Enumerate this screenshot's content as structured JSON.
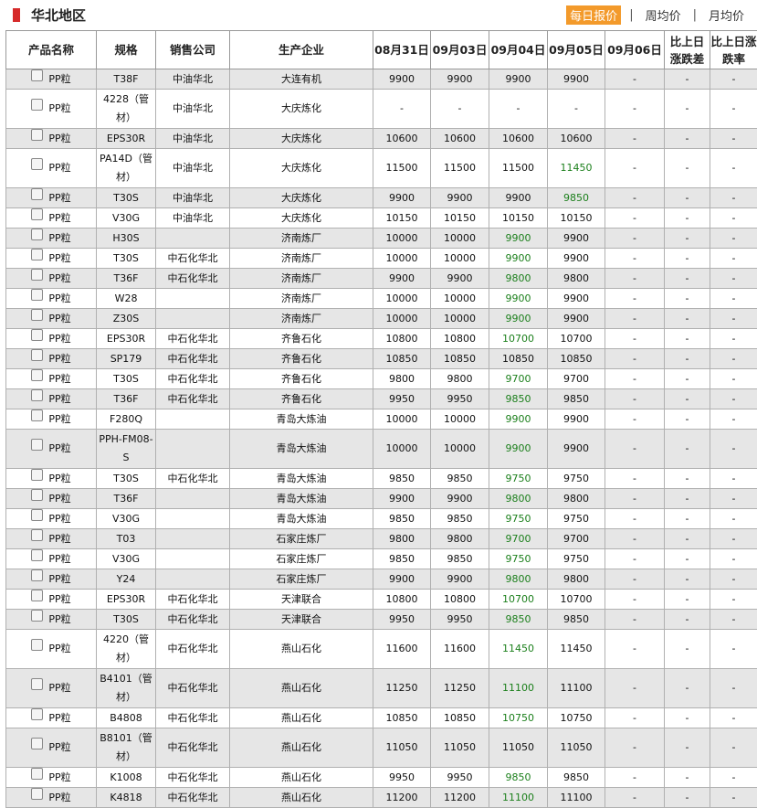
{
  "region_title": "华北地区",
  "tabs": [
    {
      "label": "每日报价",
      "active": true
    },
    {
      "label": "周均价",
      "active": false
    },
    {
      "label": "月均价",
      "active": false
    }
  ],
  "colors": {
    "accent": "#f39a2b",
    "marker": "#d62a2a",
    "down": "#1b7f1b",
    "alt_row": "#e6e6e6"
  },
  "columns": [
    "产品名称",
    "规格",
    "销售公司",
    "生产企业",
    "08月31日",
    "09月03日",
    "09月04日",
    "09月05日",
    "09月06日",
    "比上日涨跌差",
    "比上日涨跌率"
  ],
  "rows": [
    {
      "name": "PP粒",
      "spec": "T38F",
      "seller": "中油华北",
      "producer": "大连有机",
      "prices": [
        "9900",
        "9900",
        "9900",
        "9900"
      ],
      "p6": "-",
      "diff": "-",
      "rate": "-",
      "tall": false,
      "down3": false
    },
    {
      "name": "PP粒",
      "spec": "4228（管材）",
      "seller": "中油华北",
      "producer": "大庆炼化",
      "prices": [
        "-",
        "-",
        "-",
        "-"
      ],
      "p6": "-",
      "diff": "-",
      "rate": "-",
      "tall": true,
      "down3": false
    },
    {
      "name": "PP粒",
      "spec": "EPS30R",
      "seller": "中油华北",
      "producer": "大庆炼化",
      "prices": [
        "10600",
        "10600",
        "10600",
        "10600"
      ],
      "p6": "-",
      "diff": "-",
      "rate": "-",
      "tall": false,
      "down3": false
    },
    {
      "name": "PP粒",
      "spec": "PA14D（管材）",
      "seller": "中油华北",
      "producer": "大庆炼化",
      "prices": [
        "11500",
        "11500",
        "11500",
        "11450"
      ],
      "p6": "-",
      "diff": "-",
      "rate": "-",
      "tall": true,
      "down3": true
    },
    {
      "name": "PP粒",
      "spec": "T30S",
      "seller": "中油华北",
      "producer": "大庆炼化",
      "prices": [
        "9900",
        "9900",
        "9900",
        "9850"
      ],
      "p6": "-",
      "diff": "-",
      "rate": "-",
      "tall": false,
      "down3": true
    },
    {
      "name": "PP粒",
      "spec": "V30G",
      "seller": "中油华北",
      "producer": "大庆炼化",
      "prices": [
        "10150",
        "10150",
        "10150",
        "10150"
      ],
      "p6": "-",
      "diff": "-",
      "rate": "-",
      "tall": false,
      "down3": false
    },
    {
      "name": "PP粒",
      "spec": "H30S",
      "seller": "",
      "producer": "济南炼厂",
      "prices": [
        "10000",
        "10000",
        "9900",
        "9900"
      ],
      "p6": "-",
      "diff": "-",
      "rate": "-",
      "tall": false,
      "down2": true
    },
    {
      "name": "PP粒",
      "spec": "T30S",
      "seller": "中石化华北",
      "producer": "济南炼厂",
      "prices": [
        "10000",
        "10000",
        "9900",
        "9900"
      ],
      "p6": "-",
      "diff": "-",
      "rate": "-",
      "tall": false,
      "down2": true
    },
    {
      "name": "PP粒",
      "spec": "T36F",
      "seller": "中石化华北",
      "producer": "济南炼厂",
      "prices": [
        "9900",
        "9900",
        "9800",
        "9800"
      ],
      "p6": "-",
      "diff": "-",
      "rate": "-",
      "tall": false,
      "down2": true
    },
    {
      "name": "PP粒",
      "spec": "W28",
      "seller": "",
      "producer": "济南炼厂",
      "prices": [
        "10000",
        "10000",
        "9900",
        "9900"
      ],
      "p6": "-",
      "diff": "-",
      "rate": "-",
      "tall": false,
      "down2": true
    },
    {
      "name": "PP粒",
      "spec": "Z30S",
      "seller": "",
      "producer": "济南炼厂",
      "prices": [
        "10000",
        "10000",
        "9900",
        "9900"
      ],
      "p6": "-",
      "diff": "-",
      "rate": "-",
      "tall": false,
      "down2": true
    },
    {
      "name": "PP粒",
      "spec": "EPS30R",
      "seller": "中石化华北",
      "producer": "齐鲁石化",
      "prices": [
        "10800",
        "10800",
        "10700",
        "10700"
      ],
      "p6": "-",
      "diff": "-",
      "rate": "-",
      "tall": false,
      "down2": true
    },
    {
      "name": "PP粒",
      "spec": "SP179",
      "seller": "中石化华北",
      "producer": "齐鲁石化",
      "prices": [
        "10850",
        "10850",
        "10850",
        "10850"
      ],
      "p6": "-",
      "diff": "-",
      "rate": "-",
      "tall": false
    },
    {
      "name": "PP粒",
      "spec": "T30S",
      "seller": "中石化华北",
      "producer": "齐鲁石化",
      "prices": [
        "9800",
        "9800",
        "9700",
        "9700"
      ],
      "p6": "-",
      "diff": "-",
      "rate": "-",
      "tall": false,
      "down2": true
    },
    {
      "name": "PP粒",
      "spec": "T36F",
      "seller": "中石化华北",
      "producer": "齐鲁石化",
      "prices": [
        "9950",
        "9950",
        "9850",
        "9850"
      ],
      "p6": "-",
      "diff": "-",
      "rate": "-",
      "tall": false,
      "down2": true
    },
    {
      "name": "PP粒",
      "spec": "F280Q",
      "seller": "",
      "producer": "青岛大炼油",
      "prices": [
        "10000",
        "10000",
        "9900",
        "9900"
      ],
      "p6": "-",
      "diff": "-",
      "rate": "-",
      "tall": false,
      "down2": true
    },
    {
      "name": "PP粒",
      "spec": "PPH-FM08-S",
      "seller": "",
      "producer": "青岛大炼油",
      "prices": [
        "10000",
        "10000",
        "9900",
        "9900"
      ],
      "p6": "-",
      "diff": "-",
      "rate": "-",
      "tall": true,
      "down2": true
    },
    {
      "name": "PP粒",
      "spec": "T30S",
      "seller": "中石化华北",
      "producer": "青岛大炼油",
      "prices": [
        "9850",
        "9850",
        "9750",
        "9750"
      ],
      "p6": "-",
      "diff": "-",
      "rate": "-",
      "tall": false,
      "down2": true
    },
    {
      "name": "PP粒",
      "spec": "T36F",
      "seller": "",
      "producer": "青岛大炼油",
      "prices": [
        "9900",
        "9900",
        "9800",
        "9800"
      ],
      "p6": "-",
      "diff": "-",
      "rate": "-",
      "tall": false,
      "down2": true
    },
    {
      "name": "PP粒",
      "spec": "V30G",
      "seller": "",
      "producer": "青岛大炼油",
      "prices": [
        "9850",
        "9850",
        "9750",
        "9750"
      ],
      "p6": "-",
      "diff": "-",
      "rate": "-",
      "tall": false,
      "down2": true
    },
    {
      "name": "PP粒",
      "spec": "T03",
      "seller": "",
      "producer": "石家庄炼厂",
      "prices": [
        "9800",
        "9800",
        "9700",
        "9700"
      ],
      "p6": "-",
      "diff": "-",
      "rate": "-",
      "tall": false,
      "down2": true
    },
    {
      "name": "PP粒",
      "spec": "V30G",
      "seller": "",
      "producer": "石家庄炼厂",
      "prices": [
        "9850",
        "9850",
        "9750",
        "9750"
      ],
      "p6": "-",
      "diff": "-",
      "rate": "-",
      "tall": false,
      "down2": true
    },
    {
      "name": "PP粒",
      "spec": "Y24",
      "seller": "",
      "producer": "石家庄炼厂",
      "prices": [
        "9900",
        "9900",
        "9800",
        "9800"
      ],
      "p6": "-",
      "diff": "-",
      "rate": "-",
      "tall": false,
      "down2": true
    },
    {
      "name": "PP粒",
      "spec": "EPS30R",
      "seller": "中石化华北",
      "producer": "天津联合",
      "prices": [
        "10800",
        "10800",
        "10700",
        "10700"
      ],
      "p6": "-",
      "diff": "-",
      "rate": "-",
      "tall": false,
      "down2": true
    },
    {
      "name": "PP粒",
      "spec": "T30S",
      "seller": "中石化华北",
      "producer": "天津联合",
      "prices": [
        "9950",
        "9950",
        "9850",
        "9850"
      ],
      "p6": "-",
      "diff": "-",
      "rate": "-",
      "tall": false,
      "down2": true
    },
    {
      "name": "PP粒",
      "spec": "4220（管材）",
      "seller": "中石化华北",
      "producer": "燕山石化",
      "prices": [
        "11600",
        "11600",
        "11450",
        "11450"
      ],
      "p6": "-",
      "diff": "-",
      "rate": "-",
      "tall": true,
      "down2": true
    },
    {
      "name": "PP粒",
      "spec": "B4101（管材）",
      "seller": "中石化华北",
      "producer": "燕山石化",
      "prices": [
        "11250",
        "11250",
        "11100",
        "11100"
      ],
      "p6": "-",
      "diff": "-",
      "rate": "-",
      "tall": true,
      "down2": true
    },
    {
      "name": "PP粒",
      "spec": "B4808",
      "seller": "中石化华北",
      "producer": "燕山石化",
      "prices": [
        "10850",
        "10850",
        "10750",
        "10750"
      ],
      "p6": "-",
      "diff": "-",
      "rate": "-",
      "tall": false,
      "down2": true
    },
    {
      "name": "PP粒",
      "spec": "B8101（管材）",
      "seller": "中石化华北",
      "producer": "燕山石化",
      "prices": [
        "11050",
        "11050",
        "11050",
        "11050"
      ],
      "p6": "-",
      "diff": "-",
      "rate": "-",
      "tall": true
    },
    {
      "name": "PP粒",
      "spec": "K1008",
      "seller": "中石化华北",
      "producer": "燕山石化",
      "prices": [
        "9950",
        "9950",
        "9850",
        "9850"
      ],
      "p6": "-",
      "diff": "-",
      "rate": "-",
      "tall": false,
      "down2": true
    },
    {
      "name": "PP粒",
      "spec": "K4818",
      "seller": "中石化华北",
      "producer": "燕山石化",
      "prices": [
        "11200",
        "11200",
        "11100",
        "11100"
      ],
      "p6": "-",
      "diff": "-",
      "rate": "-",
      "tall": false,
      "down2": true
    }
  ]
}
